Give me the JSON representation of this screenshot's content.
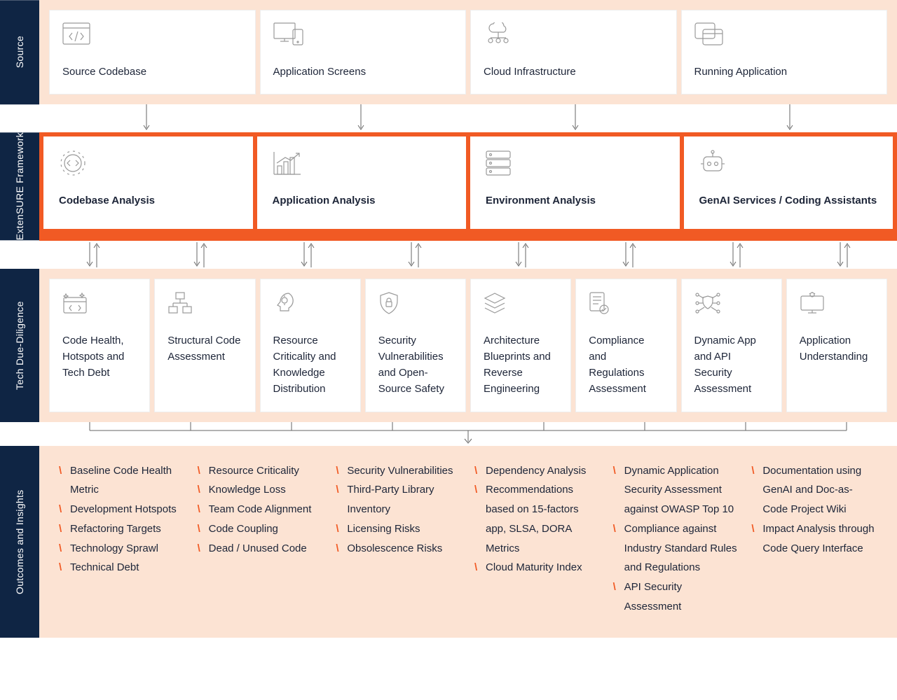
{
  "rows": {
    "source": {
      "label": "Source",
      "cards": [
        "Source Codebase",
        "Application Screens",
        "Cloud Infrastructure",
        "Running Application"
      ]
    },
    "framework": {
      "label": "ExtenSURE Framework",
      "cards": [
        "Codebase Analysis",
        "Application Analysis",
        "Environment Analysis",
        "GenAI Services / Coding Assistants"
      ]
    },
    "diligence": {
      "label": "Tech Due-Diligence",
      "cards": [
        "Code Health, Hotspots and Tech Debt",
        "Structural Code Assessment",
        "Resource Criticality and Knowledge Distribution",
        "Security Vulnerabilities and Open-Source Safety",
        "Architecture Blueprints and Reverse Engineering",
        "Compliance and Regulations Assessment",
        "Dynamic App and API Security Assessment",
        "Application Understanding"
      ]
    },
    "outcomes": {
      "label": "Outcomes and Insights",
      "cols": [
        [
          "Baseline Code Health Metric",
          "Development Hotspots",
          "Refactoring Targets",
          "Technology Sprawl",
          "Technical Debt"
        ],
        [
          "Resource Criticality",
          "Knowledge Loss",
          "Team Code Alignment",
          "Code Coupling",
          "Dead / Unused Code"
        ],
        [
          "Security Vulnerabilities",
          "Third-Party Library Inventory",
          "Licensing Risks",
          "Obsolescence Risks"
        ],
        [
          "Dependency Analysis",
          "Recommendations based on 15-factors app, SLSA, DORA Metrics",
          "Cloud Maturity Index"
        ],
        [
          "Dynamic Application Security Assessment against OWASP Top 10",
          "Compliance against Industry Standard Rules and Regulations",
          "API Security Assessment"
        ],
        [
          "Documentation using GenAI and Doc-as-Code Project Wiki",
          "Impact Analysis through Code Query Interface"
        ]
      ]
    }
  }
}
